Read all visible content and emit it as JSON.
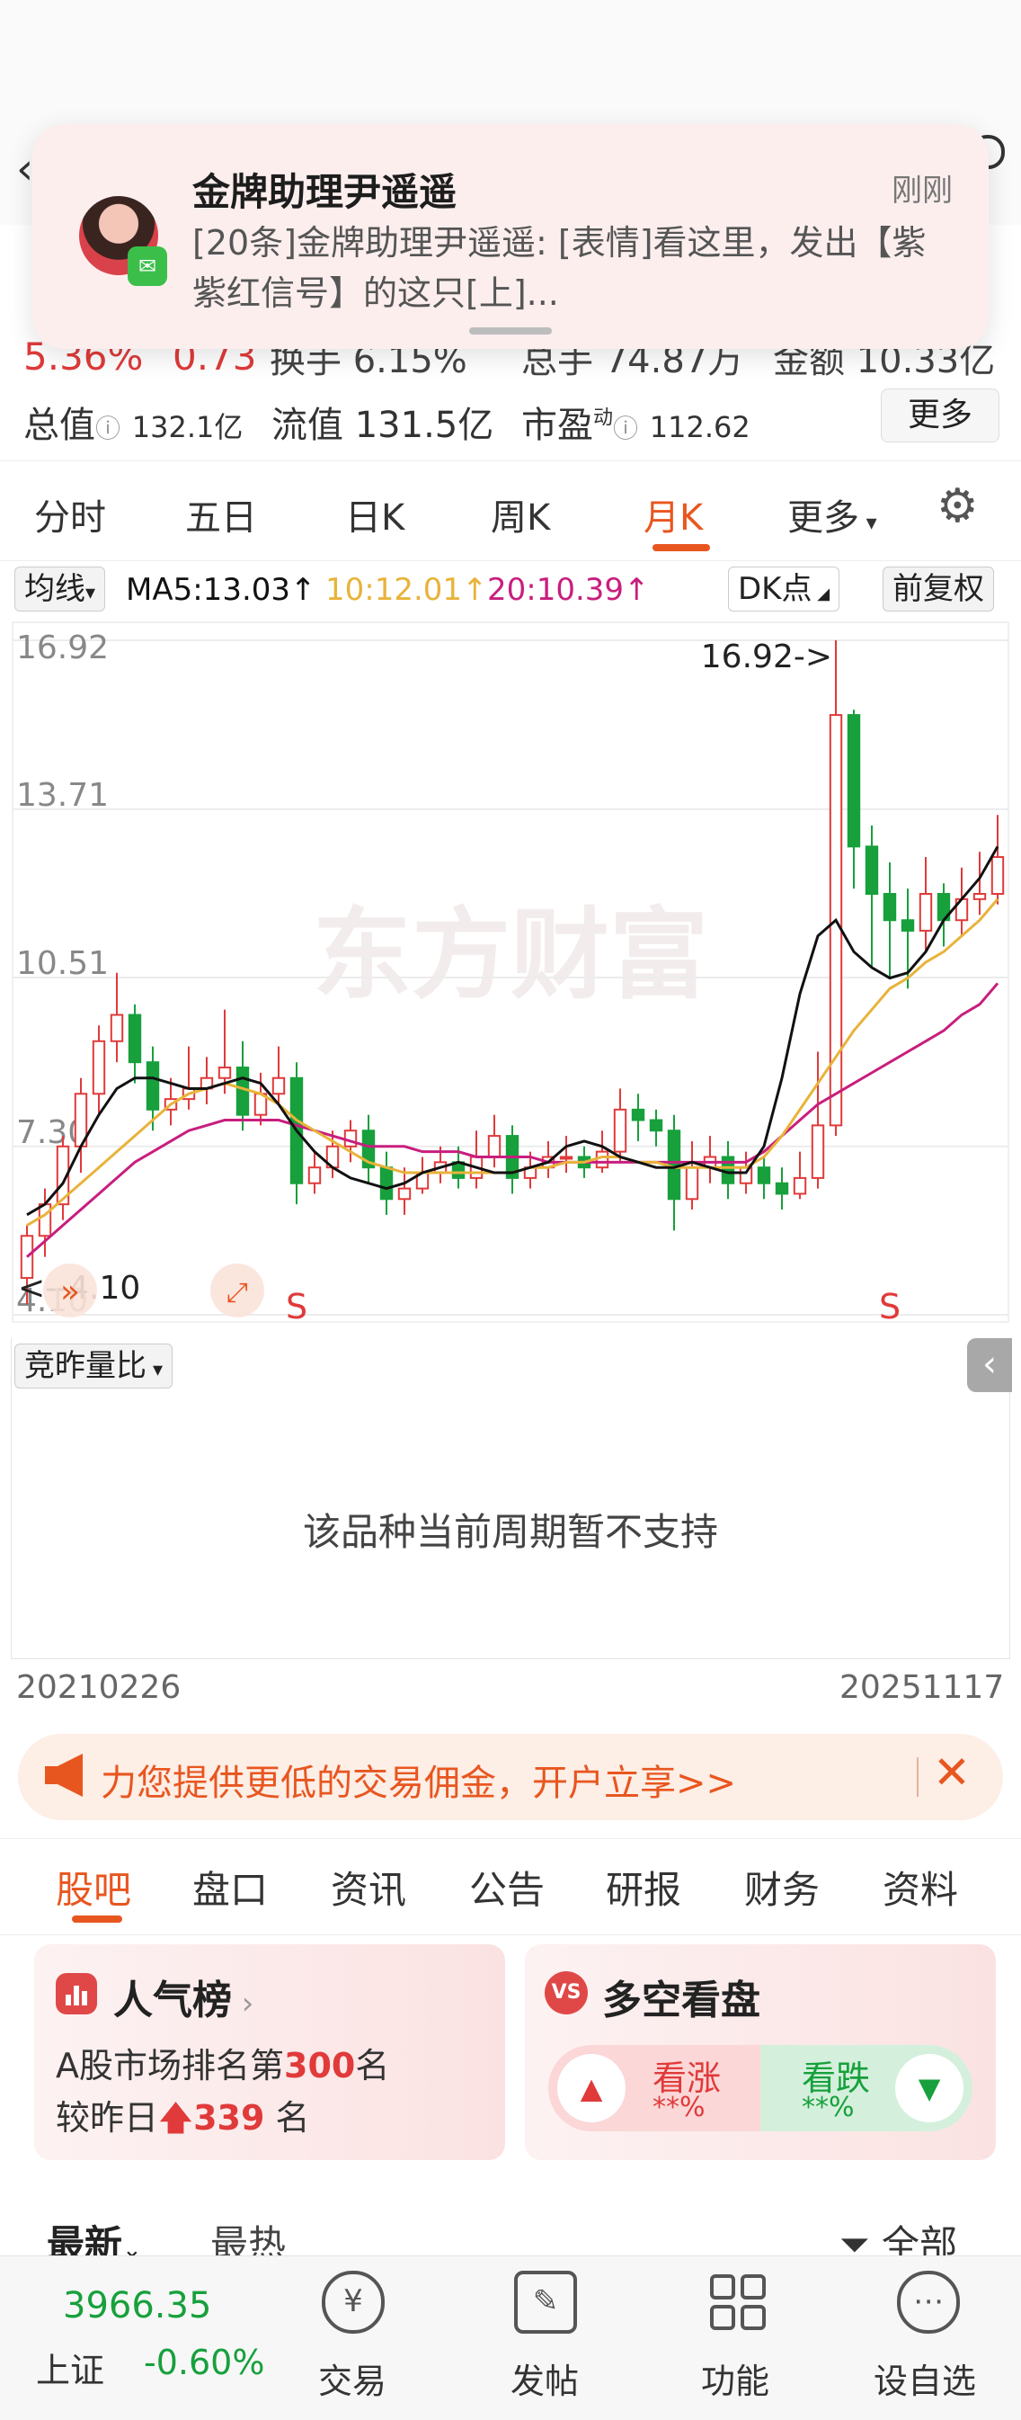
{
  "notification": {
    "sender": "金牌助理尹遥遥",
    "time": "刚刚",
    "message": "[20条]金牌助理尹遥遥: [表情]看这里，发出【紫紫红信号】的这只[上]..."
  },
  "quote": {
    "change_pct": "5.36%",
    "change_amt": "0.73",
    "turnover_label": "换手",
    "turnover_value": "6.15%",
    "volume_label": "总手",
    "volume_value": "74.87万",
    "amount_label": "金额",
    "amount_value": "10.33亿",
    "total_mv_label": "总值",
    "total_mv_value": "132.1亿",
    "float_mv_label": "流值",
    "float_mv_value": "131.5亿",
    "pe_label": "市盈",
    "pe_sup": "动",
    "pe_value": "112.62",
    "more_label": "更多"
  },
  "period_tabs": [
    "分时",
    "五日",
    "日K",
    "周K",
    "月K",
    "更多"
  ],
  "active_period": "月K",
  "chart_toolbar": {
    "ma_select": "均线",
    "ma5": "MA5:13.03",
    "ma10": "10:12.01",
    "ma20": "20:10.39",
    "dk_label": "DK点",
    "adjust_label": "前复权"
  },
  "colors": {
    "up": "#e03a3a",
    "down": "#17a03c",
    "accent": "#e8561f",
    "ma5": "#111111",
    "ma10": "#e8b33a",
    "ma20": "#c81e7e"
  },
  "chart_data": {
    "type": "candlestick",
    "y_ticks": [
      "16.92",
      "13.71",
      "10.51",
      "7.30",
      "4.10"
    ],
    "ylim": [
      4.1,
      16.92
    ],
    "high_marker": "16.92->",
    "low_marker": "<--4.10",
    "signals": [
      "S",
      "S"
    ],
    "x_start": "20210226",
    "x_end": "20251117",
    "watermark": "东方财富",
    "ma5": [
      6.0,
      6.2,
      6.6,
      7.3,
      7.9,
      8.4,
      8.6,
      8.6,
      8.5,
      8.4,
      8.4,
      8.5,
      8.6,
      8.5,
      8.1,
      7.6,
      7.2,
      6.9,
      6.7,
      6.6,
      6.5,
      6.6,
      6.8,
      6.9,
      7.0,
      6.9,
      6.8,
      6.8,
      6.9,
      7.0,
      7.3,
      7.4,
      7.3,
      7.1,
      7.0,
      6.9,
      6.9,
      7.0,
      6.9,
      6.8,
      6.8,
      7.3,
      8.6,
      10.2,
      11.3,
      11.6,
      11.0,
      10.7,
      10.5,
      10.6,
      11.0,
      11.6,
      12.0,
      12.4,
      13.0
    ],
    "ma10": [
      5.8,
      6.0,
      6.3,
      6.6,
      6.9,
      7.2,
      7.5,
      7.8,
      8.1,
      8.3,
      8.4,
      8.5,
      8.4,
      8.3,
      8.1,
      7.8,
      7.6,
      7.4,
      7.2,
      7.0,
      6.9,
      6.8,
      6.8,
      6.8,
      6.8,
      6.8,
      6.8,
      6.8,
      6.9,
      6.9,
      7.0,
      7.0,
      7.1,
      7.1,
      7.0,
      7.0,
      6.9,
      6.9,
      6.9,
      6.9,
      6.9,
      7.1,
      7.5,
      8.0,
      8.5,
      9.0,
      9.5,
      9.9,
      10.3,
      10.5,
      10.8,
      11.0,
      11.3,
      11.6,
      12.0
    ],
    "ma20": [
      5.2,
      5.5,
      5.8,
      6.1,
      6.4,
      6.7,
      7.0,
      7.2,
      7.4,
      7.6,
      7.7,
      7.8,
      7.8,
      7.8,
      7.8,
      7.7,
      7.6,
      7.5,
      7.4,
      7.3,
      7.3,
      7.3,
      7.2,
      7.2,
      7.2,
      7.1,
      7.1,
      7.1,
      7.1,
      7.0,
      7.0,
      7.0,
      7.0,
      7.0,
      7.0,
      7.0,
      7.0,
      7.0,
      7.0,
      7.0,
      7.0,
      7.2,
      7.5,
      7.8,
      8.1,
      8.3,
      8.5,
      8.7,
      8.9,
      9.1,
      9.3,
      9.5,
      9.8,
      10.0,
      10.4
    ],
    "candles": [
      [
        4.8,
        5.6,
        5.8,
        4.3
      ],
      [
        5.6,
        6.2,
        6.5,
        5.2
      ],
      [
        6.2,
        7.3,
        7.5,
        5.9
      ],
      [
        7.3,
        8.3,
        8.6,
        6.8
      ],
      [
        8.3,
        9.3,
        9.6,
        7.9
      ],
      [
        9.3,
        9.8,
        10.6,
        8.9
      ],
      [
        9.8,
        8.9,
        10.0,
        8.5
      ],
      [
        8.9,
        8.0,
        9.2,
        7.6
      ],
      [
        8.0,
        8.2,
        8.6,
        7.7
      ],
      [
        8.2,
        8.4,
        9.2,
        8.0
      ],
      [
        8.4,
        8.6,
        9.0,
        8.1
      ],
      [
        8.6,
        8.8,
        9.9,
        8.3
      ],
      [
        8.8,
        7.9,
        9.3,
        7.6
      ],
      [
        7.9,
        8.3,
        8.7,
        7.7
      ],
      [
        8.3,
        8.6,
        9.2,
        8.1
      ],
      [
        8.6,
        6.6,
        8.9,
        6.2
      ],
      [
        6.6,
        6.9,
        7.2,
        6.4
      ],
      [
        6.9,
        7.3,
        7.6,
        6.7
      ],
      [
        7.3,
        7.6,
        7.8,
        7.0
      ],
      [
        7.6,
        6.9,
        7.9,
        6.6
      ],
      [
        6.9,
        6.3,
        7.2,
        6.0
      ],
      [
        6.3,
        6.5,
        6.9,
        6.0
      ],
      [
        6.5,
        6.8,
        7.1,
        6.4
      ],
      [
        6.8,
        7.0,
        7.3,
        6.6
      ],
      [
        7.0,
        6.7,
        7.3,
        6.5
      ],
      [
        6.7,
        7.1,
        7.6,
        6.5
      ],
      [
        7.1,
        7.5,
        7.9,
        6.9
      ],
      [
        7.5,
        6.7,
        7.7,
        6.4
      ],
      [
        6.7,
        6.9,
        7.2,
        6.5
      ],
      [
        6.9,
        7.1,
        7.4,
        6.7
      ],
      [
        7.1,
        7.1,
        7.5,
        6.8
      ],
      [
        7.1,
        6.9,
        7.3,
        6.7
      ],
      [
        6.9,
        7.2,
        7.6,
        6.8
      ],
      [
        7.2,
        8.0,
        8.4,
        7.0
      ],
      [
        8.0,
        7.8,
        8.3,
        7.4
      ],
      [
        7.8,
        7.6,
        8.0,
        7.3
      ],
      [
        7.6,
        6.3,
        7.9,
        5.7
      ],
      [
        6.3,
        6.9,
        7.4,
        6.1
      ],
      [
        6.9,
        7.1,
        7.5,
        6.6
      ],
      [
        7.1,
        6.6,
        7.4,
        6.3
      ],
      [
        6.6,
        6.9,
        7.2,
        6.4
      ],
      [
        6.9,
        6.6,
        7.1,
        6.3
      ],
      [
        6.6,
        6.4,
        6.9,
        6.1
      ],
      [
        6.4,
        6.7,
        7.2,
        6.3
      ],
      [
        6.7,
        7.7,
        9.1,
        6.5
      ],
      [
        7.7,
        15.5,
        16.92,
        7.5
      ],
      [
        15.5,
        13.0,
        15.6,
        12.2
      ],
      [
        13.0,
        12.1,
        13.4,
        10.7
      ],
      [
        12.1,
        11.6,
        12.7,
        10.5
      ],
      [
        11.6,
        11.4,
        12.2,
        10.3
      ],
      [
        11.4,
        12.1,
        12.8,
        11.0
      ],
      [
        12.1,
        11.6,
        12.3,
        11.1
      ],
      [
        11.6,
        12.0,
        12.6,
        11.3
      ],
      [
        12.0,
        12.1,
        12.9,
        11.7
      ],
      [
        12.1,
        12.8,
        13.6,
        11.9
      ]
    ]
  },
  "sub_panel": {
    "indicator": "竞昨量比",
    "empty_message": "该品种当前周期暂不支持"
  },
  "banner": {
    "text": "力您提供更低的交易佣金，开户立享>>"
  },
  "content_tabs": [
    "股吧",
    "盘口",
    "资讯",
    "公告",
    "研报",
    "财务",
    "资料"
  ],
  "active_content_tab": "股吧",
  "popularity": {
    "title": "人气榜",
    "line1_prefix": "A股市场排名第",
    "rank": "300",
    "line1_suffix": "名",
    "line2_prefix": "较昨日",
    "change": "339",
    "line2_suffix": "名"
  },
  "sentiment": {
    "title": "多空看盘",
    "bull_label": "看涨",
    "bull_value": "**%",
    "bear_label": "看跌",
    "bear_value": "**%"
  },
  "feed_sort": {
    "latest": "最新",
    "hot": "最热",
    "filter": "全部"
  },
  "bottom_nav": {
    "index_value": "3966.35",
    "index_name": "上证",
    "index_change": "-0.60%",
    "items": [
      "交易",
      "发帖",
      "功能",
      "设自选"
    ]
  }
}
